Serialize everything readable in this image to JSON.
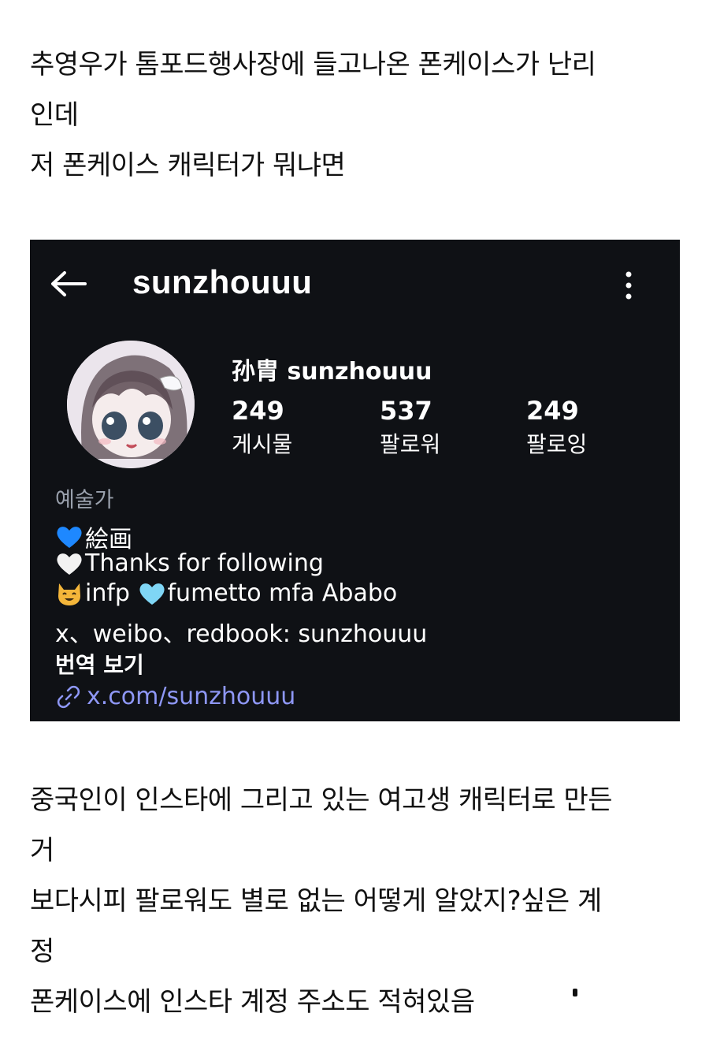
{
  "post": {
    "intro_lines": [
      "추영우가 톰포드행사장에 들고나온 폰케이스가 난리",
      "인데",
      "저 폰케이스 캐릭터가 뭐냐면"
    ],
    "outro_lines": [
      "중국인이 인스타에 그리고 있는 여고생 캐릭터로 만든",
      "거",
      "보다시피 팔로워도 별로 없는 어떻게 알았지?싶은 계",
      "정",
      "폰케이스에 인스타 계정 주소도 적혀있음"
    ]
  },
  "instagram": {
    "username": "sunzhouuu",
    "display_name": "孙胄 sunzhouuu",
    "stats": {
      "posts": {
        "value": "249",
        "label": "게시물"
      },
      "followers": {
        "value": "537",
        "label": "팔로워"
      },
      "following": {
        "value": "249",
        "label": "팔로잉"
      }
    },
    "category": "예술가",
    "bio": {
      "line1": "絵画",
      "line2": "Thanks for following",
      "line3a": "infp ",
      "line3b": "fumetto mfa Ababo",
      "line4": "x、weibo、redbook: sunzhouuu"
    },
    "translate_label": "번역 보기",
    "link_text": "x.com/sunzhouuu",
    "icons": {
      "back": "back-arrow-icon",
      "more": "more-vertical-icon",
      "link": "link-icon"
    },
    "colors": {
      "background": "#0f1115",
      "link": "#8e97f5",
      "category": "#9aa1ad",
      "blue_heart": "#1e88ff",
      "light_blue_heart": "#7fd6f5",
      "white_heart": "#f2f2f2",
      "cat_face": "#f4b63a"
    }
  }
}
